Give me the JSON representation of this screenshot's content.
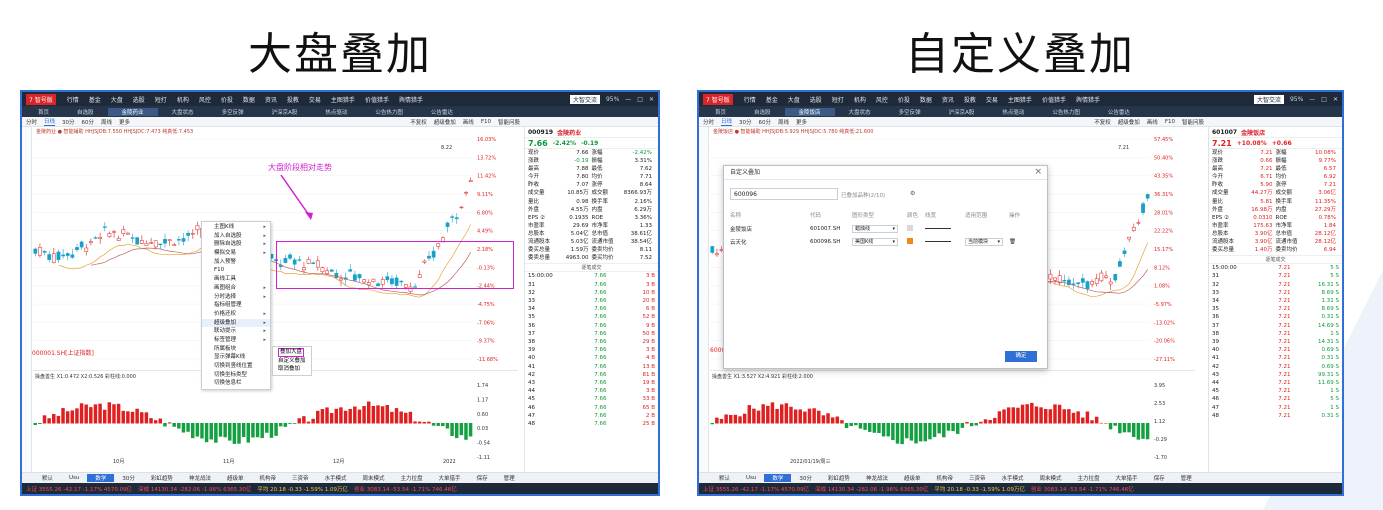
{
  "titles": {
    "left": "大盘叠加",
    "right": "自定义叠加"
  },
  "menu": {
    "logo": "7 智号版",
    "items": [
      "行情",
      "基金",
      "大盘",
      "选股",
      "短打",
      "机构",
      "风控",
      "价投",
      "数据",
      "资讯",
      "投教",
      "交易",
      "主图猎手",
      "价值猎手",
      "舆情猎手"
    ],
    "right_badge": "大智交流",
    "zoom": "95%"
  },
  "tabs": [
    "首页",
    "自选股",
    "金陵药业",
    "大盘状态",
    "多空反弹",
    "沪深京A股",
    "热点驱动",
    "公告热力图",
    "公告雷达"
  ],
  "tabs_right": [
    "首页",
    "自选股",
    "金陵饭店",
    "大盘状态",
    "多空反弹",
    "沪深京A股",
    "热点驱动",
    "公告热力图",
    "公告雷达"
  ],
  "toolbar": [
    "分时",
    "日线",
    "30分",
    "60分",
    "周线",
    "更多"
  ],
  "toolbar_right": [
    "不复权",
    "超级叠加",
    "画线",
    "F10",
    "智能问股"
  ],
  "left": {
    "stock_code": "000919",
    "stock_name": "金陵药业",
    "price": "7.66",
    "change_pct": "-2.42%",
    "change": "-0.19",
    "ma_legend": "金陵药业 ● 智能辅助  HHJSJDB:7.550  HHJSJDC:7.473  纯真低:7.453",
    "quote_rows": [
      [
        "现价",
        "7.66",
        "涨幅",
        "-2.42%"
      ],
      [
        "涨跌",
        "-0.19",
        "振幅",
        "3.31%"
      ],
      [
        "最高",
        "7.88",
        "最低",
        "7.62"
      ],
      [
        "今开",
        "7.80",
        "均价",
        "7.71"
      ],
      [
        "昨收",
        "7.07",
        "涨停",
        "8.64"
      ],
      [
        "成交量",
        "10.85万",
        "成交额",
        "8366.93万"
      ],
      [
        "量比",
        "0.98",
        "换手率",
        "2.16%"
      ],
      [
        "外盘",
        "4.55万",
        "内盘",
        "6.29万"
      ],
      [
        "EPS ②",
        "0.1935",
        "ROE",
        "3.36%"
      ],
      [
        "市盈率",
        "29.69",
        "市净率",
        "1.33"
      ],
      [
        "总股本",
        "5.04亿",
        "总市值",
        "38.61亿"
      ],
      [
        "流通股本",
        "5.03亿",
        "流通市值",
        "38.54亿"
      ],
      [
        "委买总量",
        "1.59万",
        "委卖均价",
        "8.11"
      ],
      [
        "委卖总量",
        "4963.00",
        "委买均价",
        "7.52"
      ]
    ],
    "trades_title": "逐笔成交",
    "trades": [
      [
        "15:00:00",
        "7.66",
        "3 B"
      ],
      [
        "31",
        "7.66",
        "3 B"
      ],
      [
        "32",
        "7.66",
        "10 B"
      ],
      [
        "33",
        "7.66",
        "20 B"
      ],
      [
        "34",
        "7.66",
        "6 B"
      ],
      [
        "35",
        "7.66",
        "52 B"
      ],
      [
        "36",
        "7.66",
        "9 B"
      ],
      [
        "37",
        "7.66",
        "50 B"
      ],
      [
        "38",
        "7.66",
        "29 B"
      ],
      [
        "39",
        "7.66",
        "3 B"
      ],
      [
        "40",
        "7.66",
        "4 B"
      ],
      [
        "41",
        "7.66",
        "13 B"
      ],
      [
        "42",
        "7.66",
        "81 B"
      ],
      [
        "43",
        "7.66",
        "19 B"
      ],
      [
        "44",
        "7.66",
        "3 B"
      ],
      [
        "45",
        "7.66",
        "33 B"
      ],
      [
        "46",
        "7.66",
        "65 B"
      ],
      [
        "47",
        "7.66",
        "2 B"
      ],
      [
        "48",
        "7.66",
        "25 B"
      ]
    ],
    "annotation": "大盘阶段相对走势",
    "index_label": "000001.SH[上证指数]",
    "context_menu": [
      "主图K线",
      "加入自选股",
      "删除自选股",
      "模拟交易",
      "加入预警",
      "F10",
      "画线工具",
      "画图组合",
      "分时选择",
      "指标组管理",
      "价格还权",
      "超级叠加",
      "联动提示",
      "标签管理",
      "所属板块",
      "显示弹幕K线",
      "切换到竖线位置",
      "切换坐标类型",
      "切换信息栏"
    ],
    "submenu": [
      "叠加大盘",
      "自定义叠加",
      "取消叠加"
    ],
    "y_axis": [
      "16.03%",
      "13.72%",
      "11.42%",
      "9.11%",
      "6.80%",
      "4.49%",
      "2.18%",
      "-0.13%",
      "-2.44%",
      "-4.75%",
      "-7.06%",
      "-9.37%",
      "-11.68%"
    ],
    "peak_label": "8.22",
    "sub_legend": "操盘善生  X1:0.472  X2:0.526  彩柱线:0.000",
    "sub_y_axis": [
      "1.74",
      "1.17",
      "0.60",
      "0.03",
      "-0.54",
      "-1.11"
    ],
    "x_axis": [
      "10月",
      "11月",
      "12月",
      "2022"
    ]
  },
  "right": {
    "stock_code": "601007",
    "stock_name": "金陵饭店",
    "price": "7.21",
    "change_pct": "+10.08%",
    "change": "+0.66",
    "ma_legend": "金陵饭店 ● 智能辅助  HHJSJDB:5.929  HHJSJDC:5.780  纯真低:21.600",
    "quote_rows": [
      [
        "现价",
        "7.21",
        "涨幅",
        "10.08%"
      ],
      [
        "涨跌",
        "0.66",
        "振幅",
        "9.77%"
      ],
      [
        "最高",
        "7.21",
        "最低",
        "6.57"
      ],
      [
        "今开",
        "6.71",
        "均价",
        "6.92"
      ],
      [
        "昨收",
        "5.90",
        "涨停",
        "7.21"
      ],
      [
        "成交量",
        "44.27万",
        "成交额",
        "3.06亿"
      ],
      [
        "量比",
        "5.81",
        "换手率",
        "11.35%"
      ],
      [
        "外盘",
        "16.98万",
        "内盘",
        "27.29万"
      ],
      [
        "EPS ②",
        "0.0310",
        "ROE",
        "0.78%"
      ],
      [
        "市盈率",
        "175.63",
        "市净率",
        "1.84"
      ],
      [
        "总股本",
        "3.90亿",
        "总市值",
        "28.12亿"
      ],
      [
        "流通股本",
        "3.90亿",
        "流通市值",
        "28.12亿"
      ],
      [
        "委买总量",
        "1.40万",
        "委卖均价",
        "6.94"
      ]
    ],
    "trades_title": "逐笔成交",
    "trades": [
      [
        "15:00:00",
        "7.21",
        "5 S"
      ],
      [
        "31",
        "7.21",
        "5 S"
      ],
      [
        "32",
        "7.21",
        "16.31 S"
      ],
      [
        "33",
        "7.21",
        "8.69 S"
      ],
      [
        "34",
        "7.21",
        "1.31 S"
      ],
      [
        "35",
        "7.21",
        "8.69 S"
      ],
      [
        "36",
        "7.21",
        "0.31 S"
      ],
      [
        "37",
        "7.21",
        "14.69 S"
      ],
      [
        "38",
        "7.21",
        "1 S"
      ],
      [
        "39",
        "7.21",
        "14.31 S"
      ],
      [
        "40",
        "7.21",
        "0.69 S"
      ],
      [
        "41",
        "7.21",
        "0.31 S"
      ],
      [
        "42",
        "7.21",
        "0.69 S"
      ],
      [
        "43",
        "7.21",
        "99.31 S"
      ],
      [
        "44",
        "7.21",
        "11.69 S"
      ],
      [
        "45",
        "7.21",
        "1 S"
      ],
      [
        "46",
        "7.21",
        "5 S"
      ],
      [
        "47",
        "7.21",
        "1 S"
      ],
      [
        "48",
        "7.21",
        "0.31 S"
      ]
    ],
    "y_axis": [
      "57.45%",
      "50.40%",
      "43.35%",
      "36.31%",
      "28.01%",
      "22.22%",
      "15.17%",
      "8.12%",
      "1.08%",
      "-5.97%",
      "-13.02%",
      "-20.06%",
      "-27.11%"
    ],
    "peak_label": "7.21",
    "index_label": "600096",
    "sub_legend": "操盘善生  X1:3.527  X2:4.921  彩柱线:2.000",
    "sub_y_axis": [
      "3.95",
      "2.53",
      "1.12",
      "-0.29",
      "-1.70"
    ],
    "x_axis": [
      "2022/01/19/周三"
    ],
    "dialog": {
      "title": "自定义叠加",
      "search_value": "600096",
      "added": "已叠加品种(2/10)",
      "headers": [
        "名称",
        "代码",
        "图形类型",
        "颜色",
        "线宽",
        "适用范围",
        "操作"
      ],
      "rows": [
        {
          "name": "金陵饭店",
          "code": "601007.SH",
          "type": "蜡烛线"
        },
        {
          "name": "云天化",
          "code": "600096.SH",
          "type": "美国K线",
          "scope": "当前模块"
        }
      ],
      "ok": "确定"
    }
  },
  "bottom_tabs": [
    "默认",
    "Usu",
    "数学",
    "30分",
    "彩虹趋势",
    "神龙战法",
    "超级单",
    "机构帝",
    "三资帝",
    "水手模式",
    "周末模式",
    "主力拉盘",
    "大单猎手",
    "保存",
    "管理"
  ],
  "bottom_tabs_right": [
    "新闻资讯",
    "自选股",
    "生成器",
    "机构持仓",
    "队列",
    "分时",
    "指标机单",
    "持仓基金",
    "概念主题"
  ],
  "status": {
    "sh": "上证 3555.26  -42.17  -1.17%  4570.09亿",
    "sz": "深成 14130.34  -282.06  -1.96%  6365.30亿",
    "pj": "平均 20.18  -0.33  -1.59%  1.09万亿",
    "cy": "创业 3083.14  -53.54  -1.71%  746.46亿",
    "zx": "中小 9422.95  -205.29  -2.13%  809.06亿"
  },
  "colors": {
    "up": "#e02020",
    "down": "#0a9a38",
    "accent": "#2f6fd6",
    "highlight": "#d020d0",
    "orange": "#f08a1a"
  }
}
